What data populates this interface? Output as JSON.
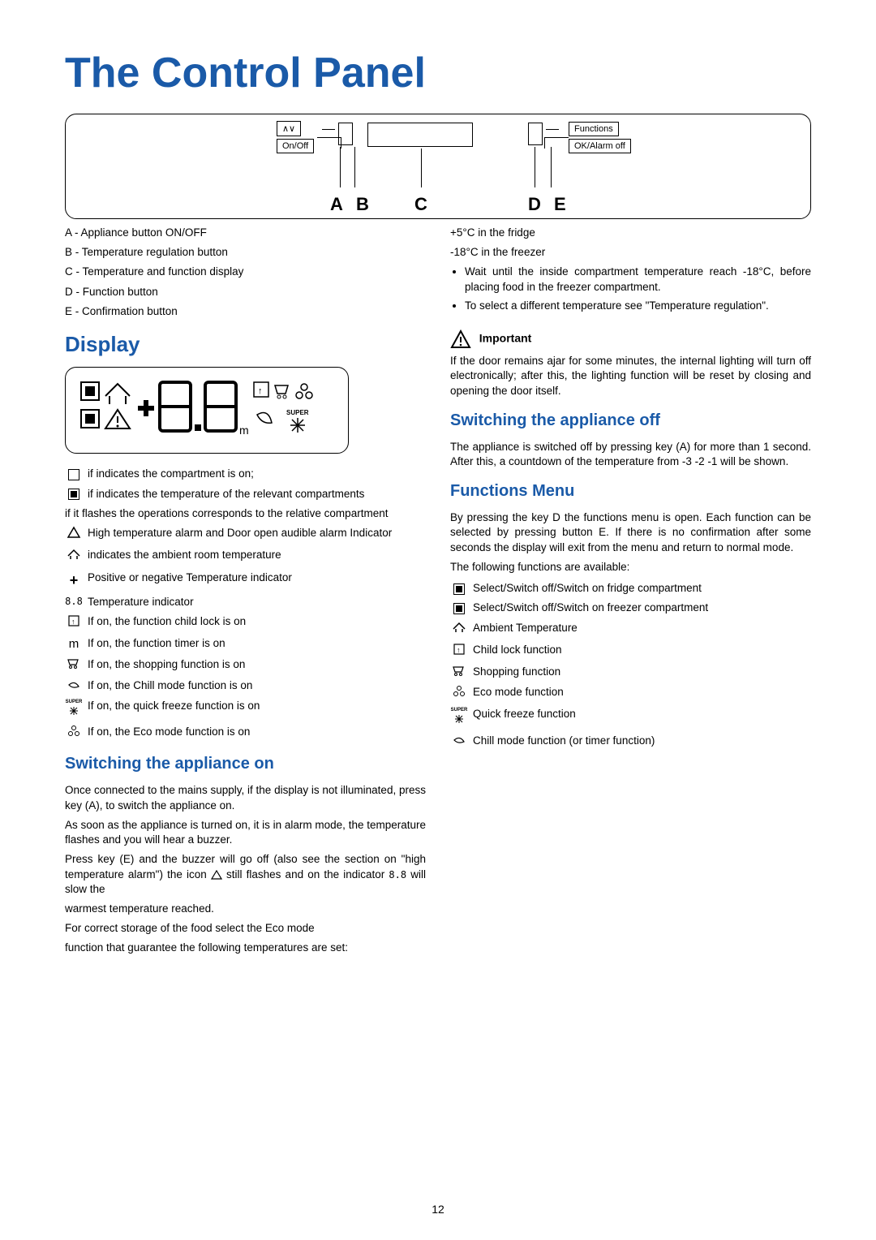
{
  "title": "The Control Panel",
  "panel": {
    "label_arrows": "∧∨",
    "label_onoff": "On/Off",
    "label_functions": "Functions",
    "label_okalarm": "OK/Alarm off",
    "letters": {
      "a": "A",
      "b": "B",
      "c": "C",
      "d": "D",
      "e": "E"
    }
  },
  "legend": {
    "a": "A - Appliance button ON/OFF",
    "b": "B - Temperature regulation button",
    "c": "C - Temperature and function display",
    "d": "D - Function button",
    "e": "E - Confirmation button"
  },
  "sections": {
    "display": "Display",
    "switch_on": "Switching the appliance on",
    "switch_off": "Switching the appliance off",
    "functions_menu": "Functions Menu"
  },
  "display_explain": {
    "line1": "if indicates the compartment is on;",
    "line2": "if indicates the temperature of the relevant compartments",
    "line3": "if it flashes the operations corresponds to the relative compartment",
    "line4": "High temperature alarm and Door open audible alarm Indicator",
    "line5": "indicates the ambient room temperature",
    "line6": "Positive or negative Temperature indicator",
    "line7": "Temperature indicator",
    "line8": "If on, the function child lock is on",
    "line9": "If on, the function timer is on",
    "line10": "If on, the shopping function is on",
    "line11": "If on, the Chill mode function is on",
    "line12": "If on, the quick freeze function is on",
    "line13": "If on, the Eco mode function is on"
  },
  "switch_on_text": {
    "p1": "Once connected to the mains supply, if the display is not illuminated, press key (A), to switch the appliance on.",
    "p2": "As soon as the appliance is turned on, it is in alarm mode, the temperature flashes and you will hear a buzzer.",
    "p3a": "Press key (E) and the buzzer will go off (also see the section on \"high temperature alarm\") the icon ",
    "p3b": " still flashes and on the indicator ",
    "p3c": " will slow the",
    "p4": "warmest temperature reached.",
    "p5": "For correct storage of the food select the Eco mode",
    "p6": "function that guarantee the following temperatures are set:"
  },
  "right_top": {
    "l1": "+5°C in the fridge",
    "l2": "-18°C in the freezer",
    "b1": "Wait until the inside compartment temperature reach -18°C, before placing food in the freezer compartment.",
    "b2": "To select a different temperature see \"Temperature regulation\"."
  },
  "important": {
    "head": "Important",
    "body": "If the door remains ajar for some minutes, the internal lighting will turn off electronically; after this, the lighting function will be reset by closing and opening the door itself."
  },
  "switch_off_text": "The appliance is switched off by pressing key (A) for more than 1 second. After this, a countdown of the temperature from -3 -2 -1 will be shown.",
  "functions_text": {
    "p1": "By pressing the key D the functions menu is open. Each function can be selected by pressing button E. If there is no confirmation after some seconds the display will exit from the menu and return  to normal mode.",
    "p2": "The following functions are available:"
  },
  "functions_list": {
    "f1": "Select/Switch off/Switch on fridge compartment",
    "f2": "Select/Switch off/Switch on freezer compartment",
    "f3": "Ambient Temperature",
    "f4": "Child lock function",
    "f5": "Shopping function",
    "f6": "Eco mode function",
    "f7": "Quick freeze function",
    "f8": "Chill mode function (or timer function)"
  },
  "icon_text": {
    "seg": "8.8",
    "m": "m",
    "super": "SUPER"
  },
  "page": "12"
}
